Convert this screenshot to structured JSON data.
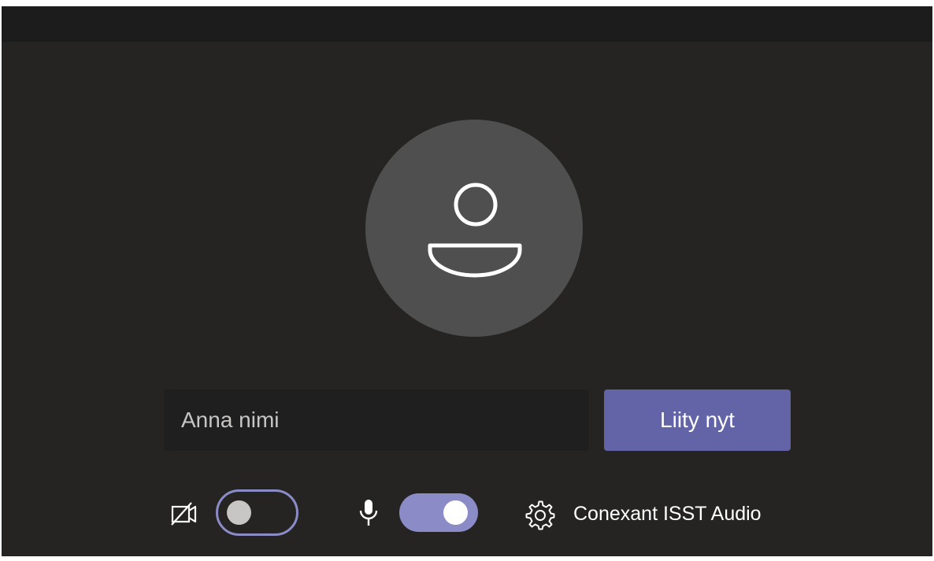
{
  "prejoin": {
    "name_input": {
      "placeholder": "Anna nimi",
      "value": ""
    },
    "join_button_label": "Liity nyt",
    "camera": {
      "icon": "camera-off-icon",
      "enabled": false
    },
    "microphone": {
      "icon": "microphone-icon",
      "enabled": true
    },
    "audio_device": {
      "icon": "gear-icon",
      "label": "Conexant ISST Audio"
    },
    "colors": {
      "accent": "#6264a7",
      "toggle_accent": "#8b8cc7",
      "background": "#252423",
      "avatar": "#4f4f4f"
    }
  }
}
